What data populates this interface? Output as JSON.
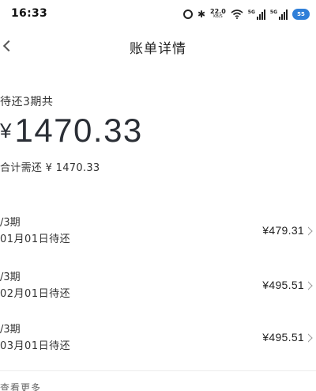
{
  "status_bar": {
    "time": "16:33",
    "net_speed_value": "22.0",
    "net_speed_unit": "KB/S",
    "sig1_tag": "5G",
    "sig2_tag": "5G",
    "cloud_label": "55"
  },
  "nav": {
    "title": "账单详情"
  },
  "summary": {
    "pending_label": "待还3期共",
    "currency": "¥",
    "amount": "1470.33",
    "total_line": "合计需还 ¥ 1470.33"
  },
  "installments": [
    {
      "period": "/3期",
      "date": "01月01日待还",
      "amount": "¥479.31"
    },
    {
      "period": "/3期",
      "date": "02月01日待还",
      "amount": "¥495.51"
    },
    {
      "period": "/3期",
      "date": "03月01日待还",
      "amount": "¥495.51"
    }
  ],
  "more": {
    "label": "查看更多"
  }
}
